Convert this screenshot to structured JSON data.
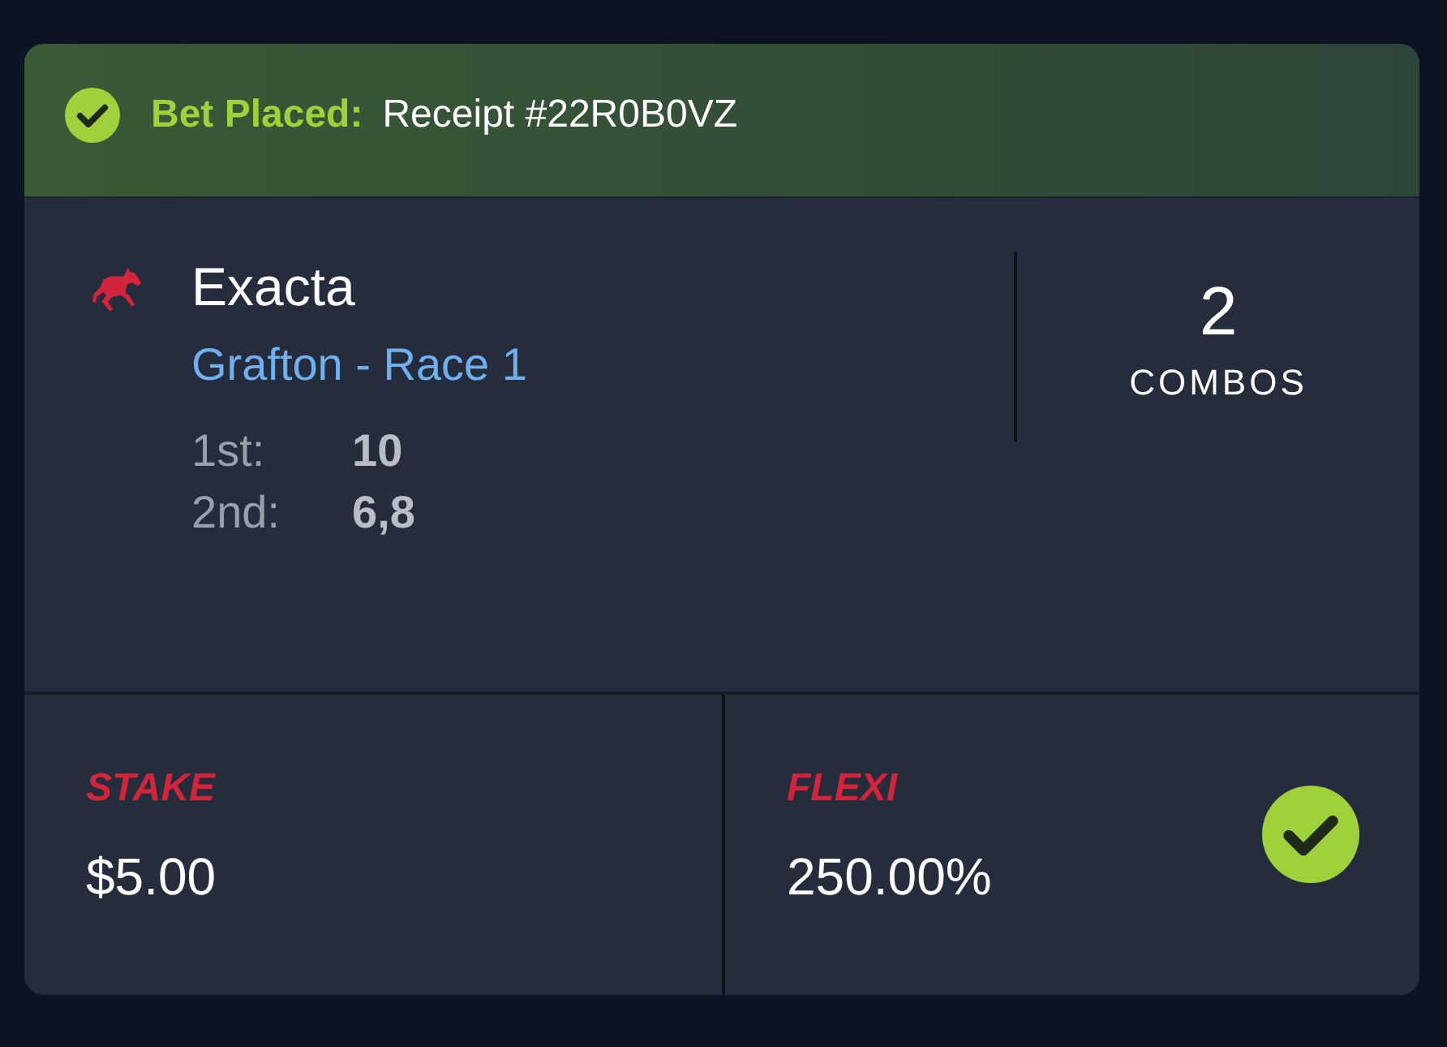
{
  "status": {
    "label": "Bet Placed:",
    "receipt": "Receipt #22R0B0VZ",
    "success": true
  },
  "bet": {
    "type": "Exacta",
    "race": "Grafton - Race 1",
    "selections": [
      {
        "position": "1st:",
        "runners": "10"
      },
      {
        "position": "2nd:",
        "runners": "6,8"
      }
    ],
    "combos": {
      "count": "2",
      "label": "COMBOS"
    }
  },
  "footer": [
    {
      "label": "STAKE",
      "value": "$5.00",
      "confirmed": false
    },
    {
      "label": "FLEXI",
      "value": "250.00%",
      "confirmed": true
    }
  ]
}
